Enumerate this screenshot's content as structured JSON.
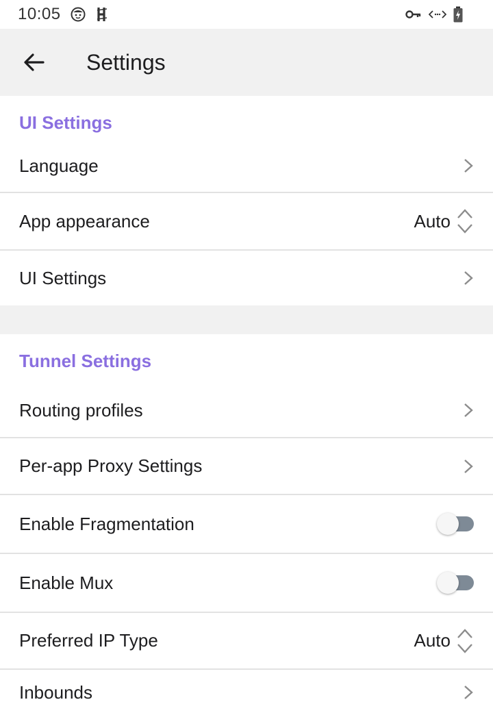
{
  "status_bar": {
    "time": "10:05",
    "left_icons": [
      "face-icon",
      "h-notification-icon"
    ],
    "right_icons": [
      "vpn-key-icon",
      "code-icon",
      "battery-icon"
    ]
  },
  "app_bar": {
    "title": "Settings",
    "back_icon": "arrow-left-icon"
  },
  "sections": {
    "ui": {
      "header": "UI Settings",
      "items": [
        {
          "label": "Language",
          "control": "chevron"
        },
        {
          "label": "App appearance",
          "control": "select",
          "value": "Auto"
        },
        {
          "label": "UI Settings",
          "control": "chevron"
        }
      ]
    },
    "tunnel": {
      "header": "Tunnel Settings",
      "items": [
        {
          "label": "Routing profiles",
          "control": "chevron"
        },
        {
          "label": "Per-app Proxy Settings",
          "control": "chevron"
        },
        {
          "label": "Enable Fragmentation",
          "control": "toggle",
          "enabled": false
        },
        {
          "label": "Enable Mux",
          "control": "toggle",
          "enabled": false
        },
        {
          "label": "Preferred IP Type",
          "control": "select",
          "value": "Auto"
        },
        {
          "label": "Inbounds",
          "control": "chevron"
        }
      ]
    }
  },
  "colors": {
    "accent": "#8a6fe0",
    "background": "#ffffff",
    "band": "#f1f1f1",
    "divider": "#e2e2e2",
    "toggle_off_track": "#7e8a96"
  }
}
